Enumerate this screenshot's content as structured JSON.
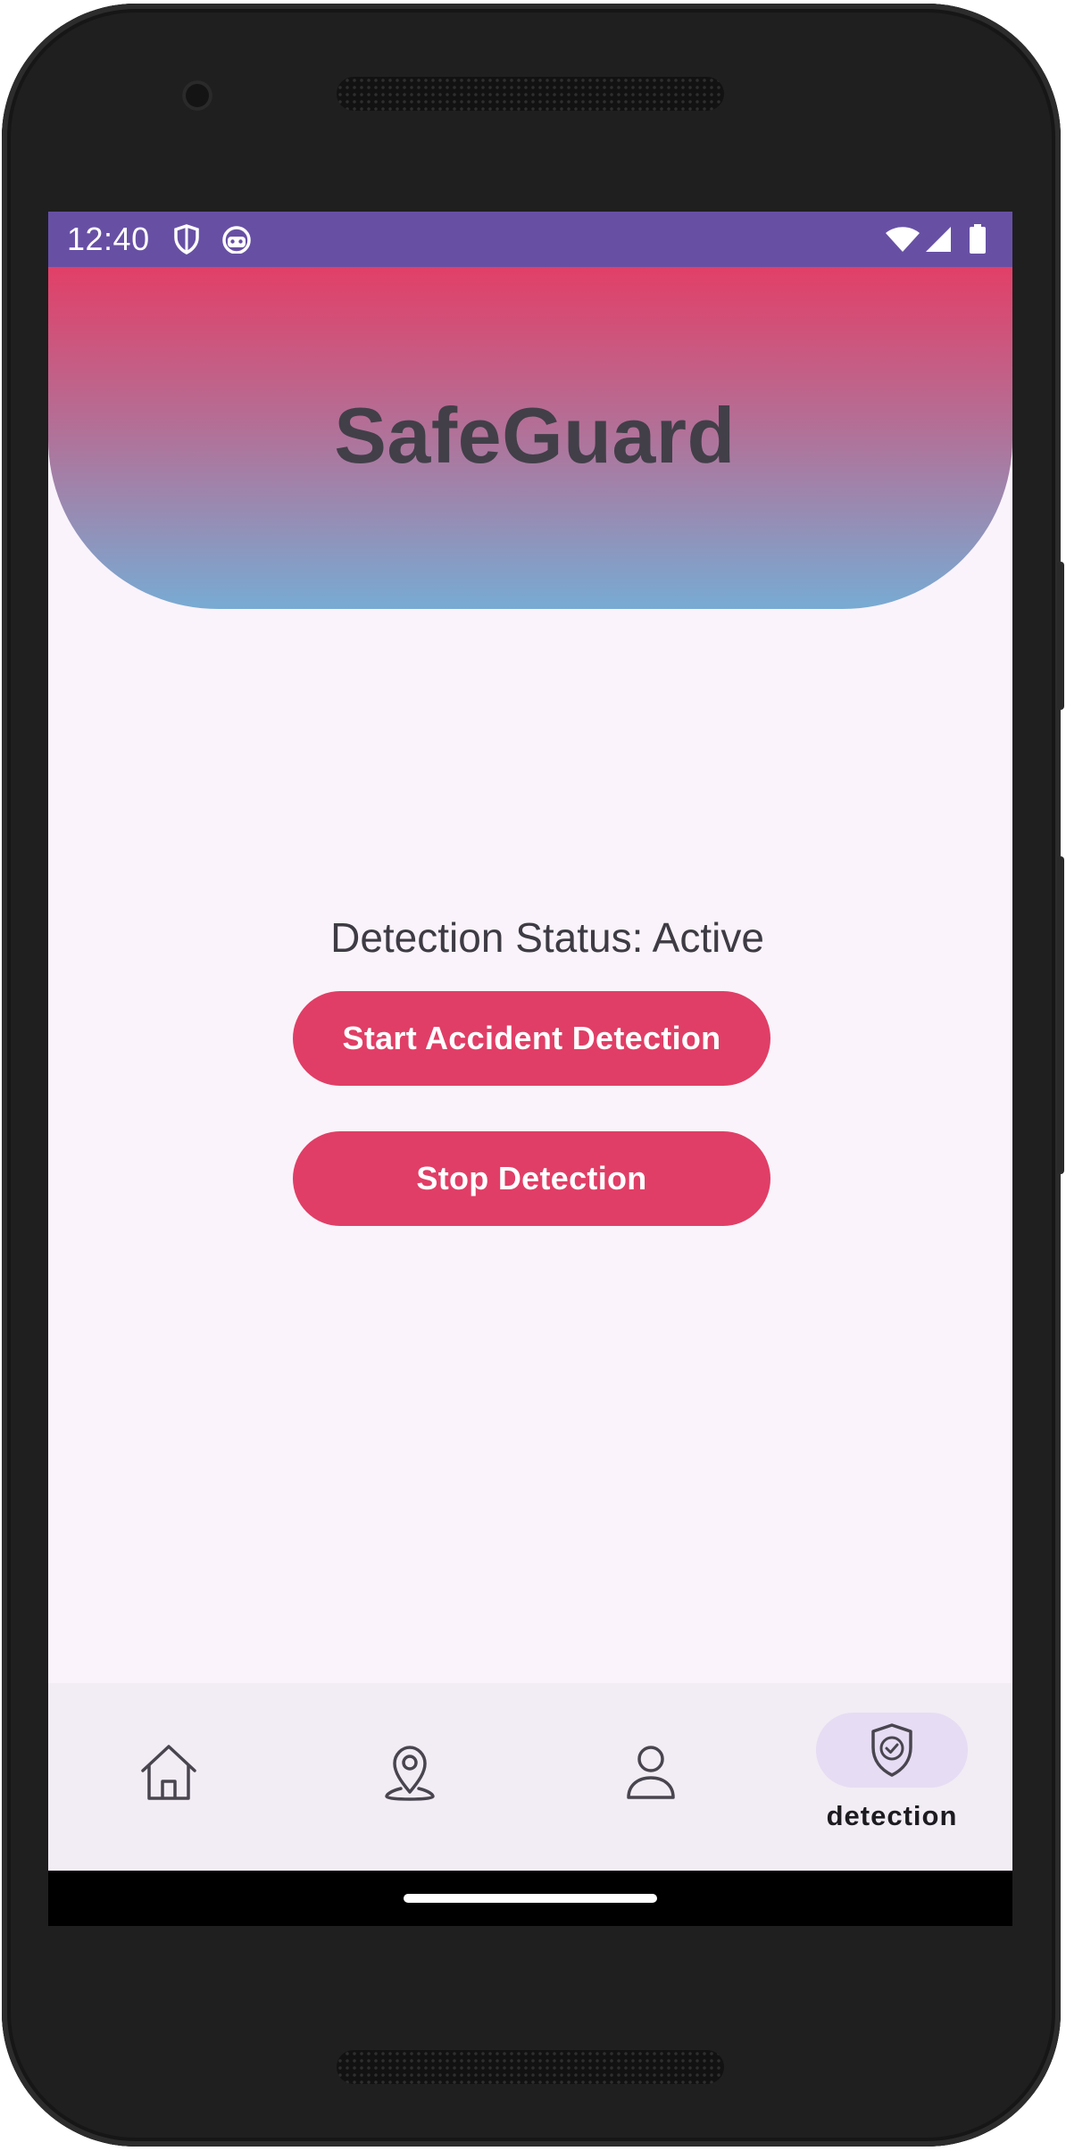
{
  "status_bar": {
    "time": "12:40",
    "icons_left": [
      "shield-icon",
      "android-robot-icon"
    ],
    "icons_right": [
      "wifi-icon",
      "signal-icon",
      "battery-icon"
    ]
  },
  "header": {
    "title": "SafeGuard"
  },
  "main": {
    "detection_status": "Detection Status: Active",
    "start_button_label": "Start Accident Detection",
    "stop_button_label": "Stop Detection"
  },
  "bottom_nav": {
    "items": [
      {
        "icon": "home-icon",
        "label": ""
      },
      {
        "icon": "location-pin-icon",
        "label": ""
      },
      {
        "icon": "person-icon",
        "label": ""
      },
      {
        "icon": "shield-check-icon",
        "label": "detection",
        "selected": true
      }
    ]
  },
  "colors": {
    "status_bar": "#6750a4",
    "header_top": "#e23f67",
    "header_bottom": "#78abd3",
    "button": "#e03e66",
    "background": "#faf3fb",
    "nav_background": "#f2ecf5",
    "nav_selected_pill": "#e6dcf3"
  }
}
